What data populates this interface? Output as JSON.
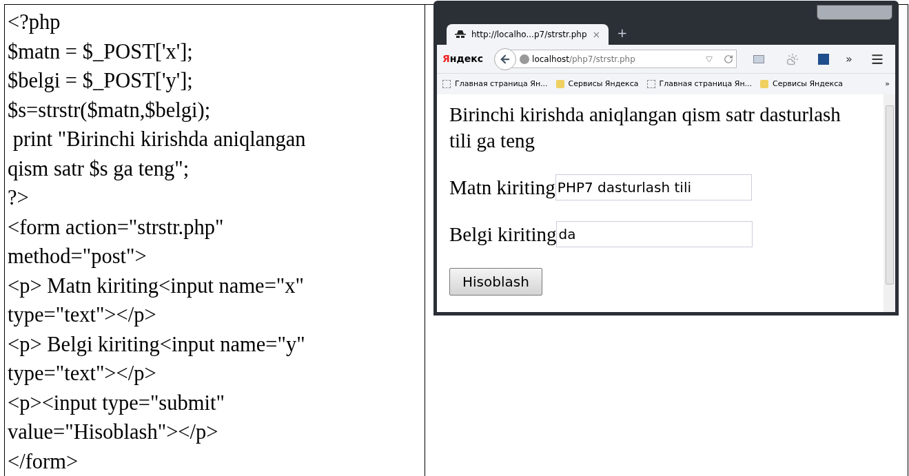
{
  "code_lines": [
    "<?php",
    "$matn = $_POST['x'];",
    "$belgi = $_POST['y'];",
    "$s=strstr($matn,$belgi);",
    " print \"Birinchi kirishda aniqlangan",
    "qism satr $s ga teng\";",
    "?>",
    "<form action=\"strstr.php\"",
    "method=\"post\">",
    "<p> Matn kiriting<input name=\"x\"",
    "type=\"text\"></p>",
    "<p> Belgi kiriting<input name=\"y\"",
    "type=\"text\"></p>",
    "<p><input type=\"submit\"",
    "value=\"Hisoblash\"></p>",
    "</form>"
  ],
  "browser": {
    "tab": {
      "title": "http://localho...p7/strstr.php",
      "close": "×"
    },
    "new_tab": "+",
    "brand": "Яндекс",
    "address": {
      "host": "localhost",
      "path": "/php7/strstr.php"
    },
    "overflow": "»",
    "bookmarks": [
      {
        "kind": "page",
        "label": "Главная страница Ян..."
      },
      {
        "kind": "folder",
        "label": "Сервисы Яндекса"
      },
      {
        "kind": "page",
        "label": "Главная страница Ян..."
      },
      {
        "kind": "folder",
        "label": "Сервисы Яндекса"
      }
    ],
    "bookmarks_more": "»",
    "page": {
      "result": "Birinchi kirishda aniqlangan qism satr dasturlash tili ga teng",
      "fields": [
        {
          "label": "Matn kiriting",
          "value": "PHP7 dasturlash tili"
        },
        {
          "label": "Belgi kiriting",
          "value": "da"
        }
      ],
      "submit": "Hisoblash"
    }
  }
}
